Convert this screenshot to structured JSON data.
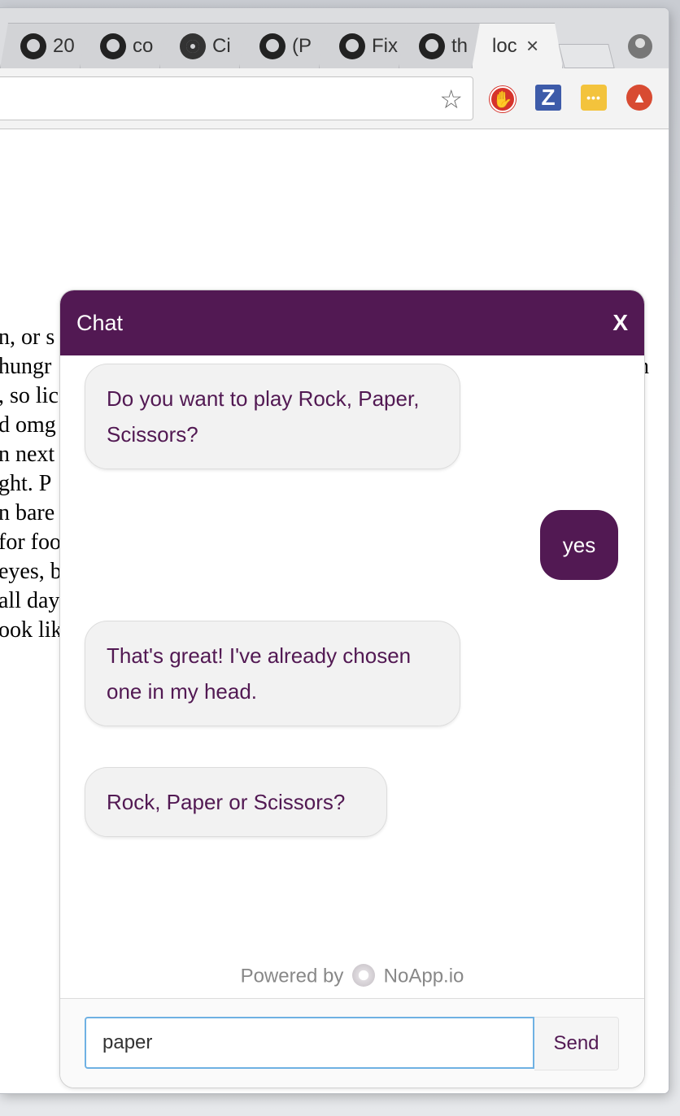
{
  "browser": {
    "tabs": [
      {
        "title": "20",
        "icon": "github-icon"
      },
      {
        "title": "co",
        "icon": "github-icon"
      },
      {
        "title": "Ci",
        "icon": "circleci-icon"
      },
      {
        "title": "(P",
        "icon": "github-icon"
      },
      {
        "title": "Fix",
        "icon": "github-icon"
      },
      {
        "title": "th",
        "icon": "github-icon"
      },
      {
        "title": "loc",
        "icon": "none",
        "active": true
      }
    ],
    "tab_close_glyph": "×",
    "bookmark_glyph": "☆",
    "extensions": {
      "adblock_glyph": "✋",
      "z_glyph": "Z",
      "dots_glyph": "•••",
      "up_glyph": "▲"
    }
  },
  "page_text": {
    "lines": [
      "n, or s",
      "hungr",
      ", so lic",
      "d omg",
      "n next",
      "ght. P",
      "n bare",
      "for foo",
      "eyes, b",
      "all day",
      "ook lik"
    ],
    "right_fragments": [
      "n",
      ","
    ]
  },
  "chat": {
    "title": "Chat",
    "close_label": "X",
    "messages": [
      {
        "from": "bot",
        "text": "Do you want to play Rock, Paper, Scissors?"
      },
      {
        "from": "user",
        "text": "yes"
      },
      {
        "from": "bot",
        "text": "That's great! I've already chosen one in my head."
      },
      {
        "from": "bot",
        "text": "Rock, Paper or Scissors?"
      }
    ],
    "powered_prefix": "Powered by",
    "powered_brand": "NoApp.io",
    "input_value": "paper",
    "send_label": "Send",
    "colors": {
      "brand": "#521953",
      "bubble_bg": "#f2f2f2",
      "input_focus": "#6fb1e3"
    }
  }
}
